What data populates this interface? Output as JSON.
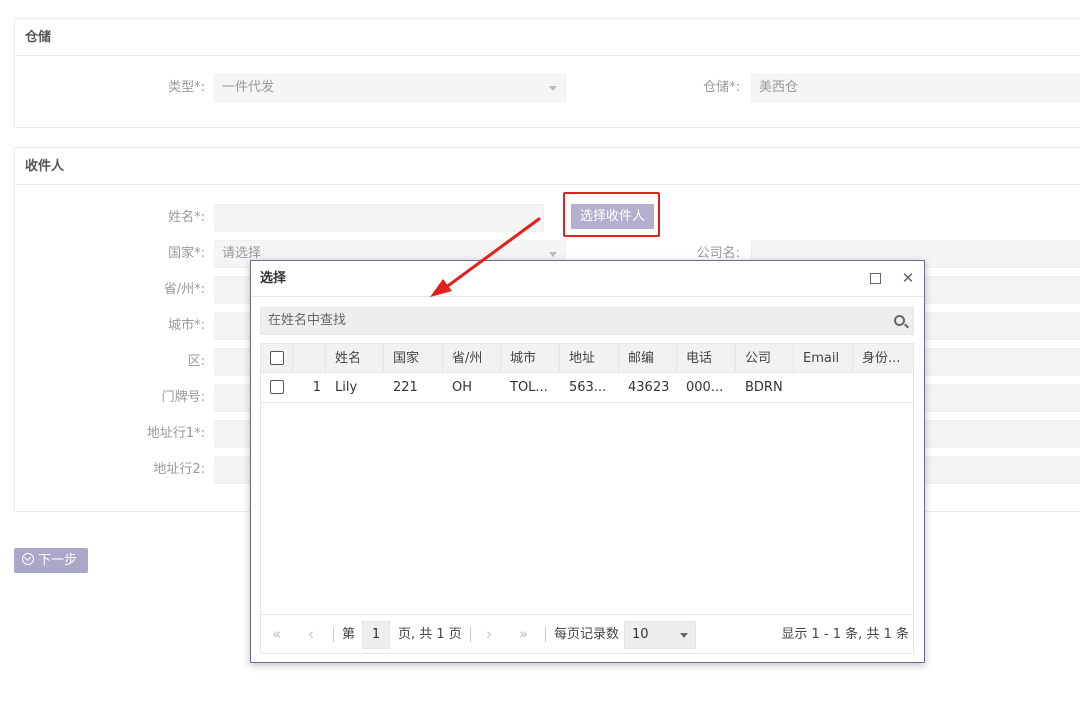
{
  "warehouse": {
    "title": "仓储",
    "type_label": "类型*:",
    "type_value": "一件代发",
    "warehouse_label": "仓储*:",
    "warehouse_value": "美西仓"
  },
  "recipient": {
    "title": "收件人",
    "name_label": "姓名*:",
    "country_label": "国家*:",
    "country_placeholder": "请选择",
    "company_label": "公司名:",
    "province_label": "省/州*:",
    "city_label": "城市*:",
    "district_label": "区:",
    "house_label": "门牌号:",
    "addr1_label": "地址行1*:",
    "addr2_label": "地址行2:",
    "select_button": "选择收件人"
  },
  "next_button": "下一步",
  "dialog": {
    "title": "选择",
    "search_placeholder": "在姓名中查找",
    "columns": [
      "姓名",
      "国家",
      "省/州",
      "城市",
      "地址",
      "邮编",
      "电话",
      "公司",
      "Email",
      "身份..."
    ],
    "rows": [
      {
        "index": "1",
        "name": "Lily",
        "country": "221",
        "province": "OH",
        "city": "TOL...",
        "address": "563...",
        "zip": "43623",
        "phone": "000...",
        "company": "BDRN",
        "email": "",
        "id": ""
      }
    ],
    "pager": {
      "page_prefix": "第",
      "page_value": "1",
      "page_suffix": "页, 共 1 页",
      "page_size_label": "每页记录数",
      "page_size_value": "10",
      "summary": "显示 1 - 1 条, 共 1 条"
    }
  },
  "colors": {
    "accent": "#b3b0cf",
    "highlight_border": "#e0211c",
    "arrow": "#e0211c"
  }
}
